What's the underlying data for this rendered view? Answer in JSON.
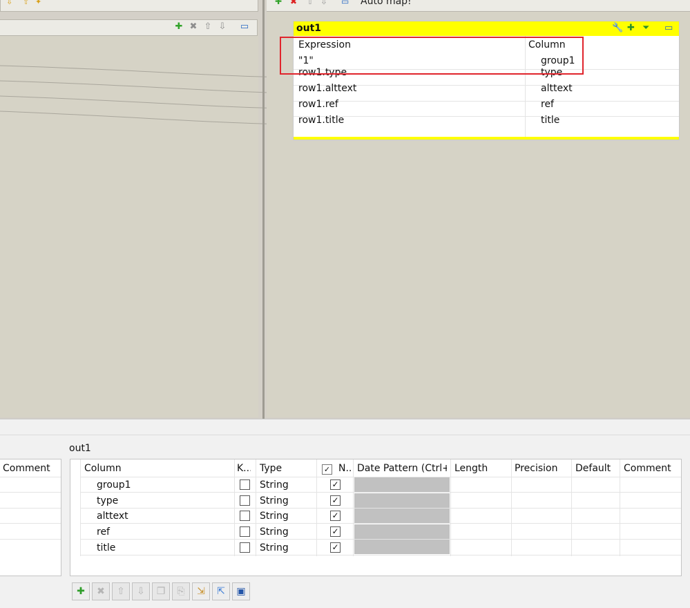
{
  "top_left_toolbar": {
    "icons": [
      "arrow-down-icon",
      "arrow-up-icon",
      "auto-icon"
    ]
  },
  "left_header": {
    "icons": [
      "add-icon",
      "delete-icon",
      "move-up-icon",
      "move-down-icon",
      "minimize-icon"
    ]
  },
  "top_right_toolbar": {
    "automap_label": "Auto map!",
    "icons": [
      "add-icon",
      "delete-icon",
      "move-up-icon",
      "move-down-icon",
      "minimize-icon"
    ]
  },
  "out1_table": {
    "title": "out1",
    "title_icons": [
      "wrench-icon",
      "add-output-icon",
      "filter-icon",
      "minimize-icon"
    ],
    "headers": {
      "expression": "Expression",
      "column": "Column"
    },
    "rows": [
      {
        "expression": "\"1\"",
        "column": "group1"
      },
      {
        "expression": "row1.type",
        "column": "type"
      },
      {
        "expression": "row1.alttext",
        "column": "alttext"
      },
      {
        "expression": "row1.ref",
        "column": "ref"
      },
      {
        "expression": "row1.title",
        "column": "title"
      }
    ],
    "highlight_color": "#e0242c",
    "title_color": "#ffff00"
  },
  "bottom_left": {
    "header": "Comment"
  },
  "schema": {
    "title": "out1",
    "headers": {
      "column": "Column",
      "key": "K...",
      "type": "Type",
      "nullable": "N...",
      "date_pattern": "Date Pattern (Ctrl+...",
      "length": "Length",
      "precision": "Precision",
      "default": "Default",
      "comment": "Comment"
    },
    "rows": [
      {
        "column": "group1",
        "type": "String",
        "key": false,
        "nullable": true
      },
      {
        "column": "type",
        "type": "String",
        "key": false,
        "nullable": true
      },
      {
        "column": "alttext",
        "type": "String",
        "key": false,
        "nullable": true
      },
      {
        "column": "ref",
        "type": "String",
        "key": false,
        "nullable": true
      },
      {
        "column": "title",
        "type": "String",
        "key": false,
        "nullable": true
      }
    ]
  },
  "bottom_buttons": [
    "add-icon",
    "delete-icon",
    "move-up-icon",
    "move-down-icon",
    "copy-icon",
    "paste-icon",
    "import-icon",
    "export-icon",
    "save-icon"
  ]
}
